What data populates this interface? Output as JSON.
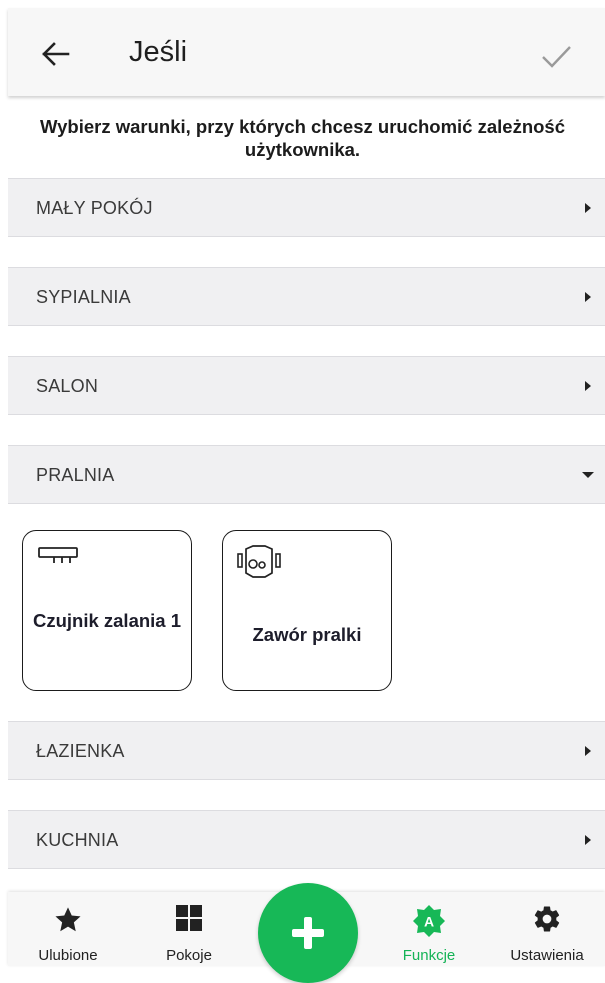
{
  "header": {
    "title": "Jeśli"
  },
  "instruction": "Wybierz warunki, przy których chcesz uruchomić zależność użytkownika.",
  "rooms": [
    {
      "label": "MAŁY POKÓJ",
      "expanded": false
    },
    {
      "label": "SYPIALNIA",
      "expanded": false
    },
    {
      "label": "SALON",
      "expanded": false
    },
    {
      "label": "PRALNIA",
      "expanded": true,
      "devices": [
        {
          "name": "Czujnik zalania 1",
          "icon": "flood-sensor-icon"
        },
        {
          "name": "Zawór pralki",
          "icon": "washer-valve-icon"
        }
      ]
    },
    {
      "label": "ŁAZIENKA",
      "expanded": false
    },
    {
      "label": "KUCHNIA",
      "expanded": false
    }
  ],
  "nav": {
    "items": [
      {
        "label": "Ulubione",
        "icon": "star-icon",
        "active": false
      },
      {
        "label": "Pokoje",
        "icon": "grid-icon",
        "active": false
      },
      {
        "label": "Funkcje",
        "icon": "functions-icon",
        "active": true
      },
      {
        "label": "Ustawienia",
        "icon": "gear-icon",
        "active": false
      }
    ],
    "fab_icon": "plus-icon"
  },
  "colors": {
    "accent": "#17b857",
    "active_label": "#14b356"
  }
}
